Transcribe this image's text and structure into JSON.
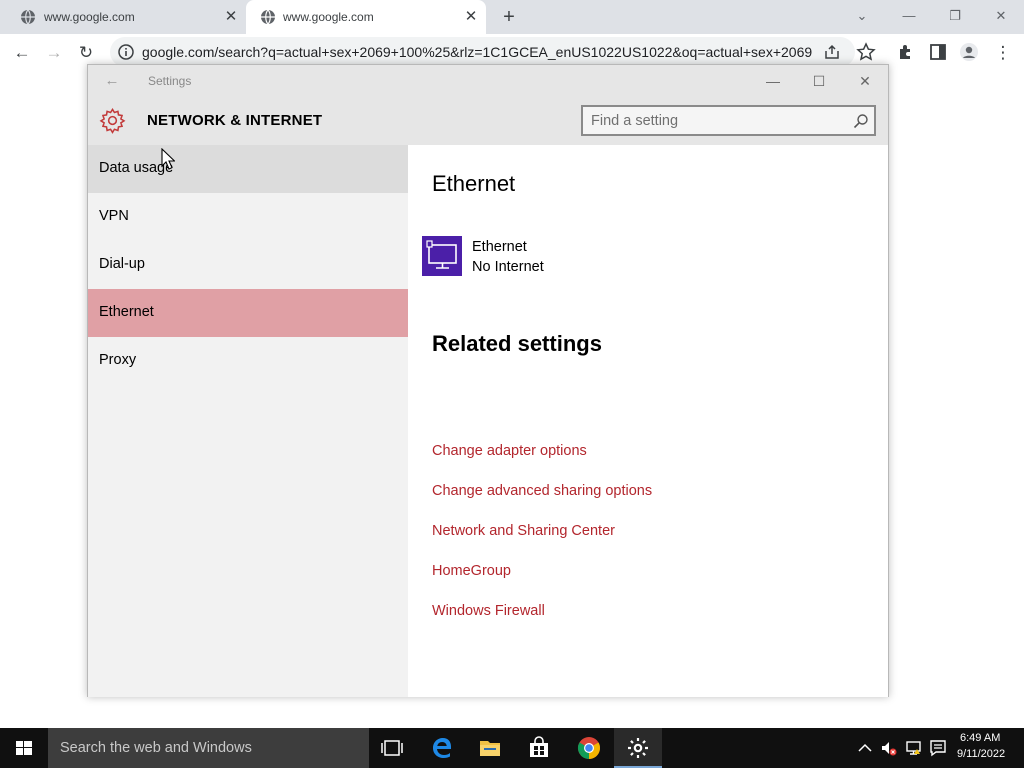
{
  "browser": {
    "tabs": [
      {
        "title": "www.google.com",
        "active": false
      },
      {
        "title": "www.google.com",
        "active": true
      }
    ],
    "url": "google.com/search?q=actual+sex+2069+100%25&rlz=1C1GCEA_enUS1022US1022&oq=actual+sex+2069..."
  },
  "settings": {
    "window_title": "Settings",
    "heading": "NETWORK & INTERNET",
    "search_placeholder": "Find a setting",
    "nav": [
      {
        "label": "Data usage",
        "state": "hover"
      },
      {
        "label": "VPN",
        "state": "normal"
      },
      {
        "label": "Dial-up",
        "state": "normal"
      },
      {
        "label": "Ethernet",
        "state": "selected"
      },
      {
        "label": "Proxy",
        "state": "normal"
      }
    ],
    "content": {
      "title": "Ethernet",
      "connection": {
        "name": "Ethernet",
        "status": "No Internet",
        "icon": "ethernet-monitor-icon"
      },
      "related_title": "Related settings",
      "related_links": [
        "Change adapter options",
        "Change advanced sharing options",
        "Network and Sharing Center",
        "HomeGroup",
        "Windows Firewall"
      ]
    },
    "colors": {
      "accent": "#b3262d",
      "selected_nav": "#e0a0a5",
      "tile": "#4b1fa8"
    }
  },
  "taskbar": {
    "search_text": "Search the web and Windows",
    "time": "6:49 AM",
    "date": "9/11/2022",
    "apps": [
      "task-view-icon",
      "edge-icon",
      "file-explorer-icon",
      "store-icon",
      "chrome-icon",
      "settings-icon"
    ]
  }
}
